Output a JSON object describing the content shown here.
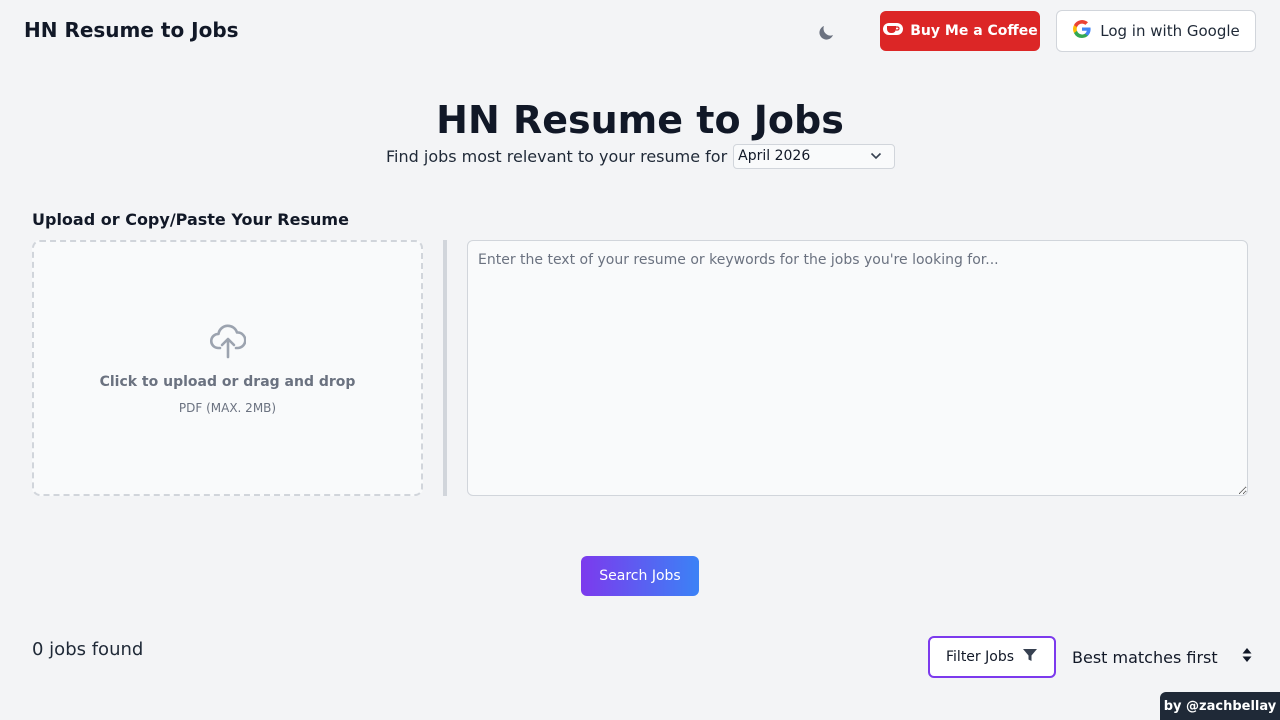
{
  "header": {
    "brand": "HN Resume to Jobs",
    "theme_toggle_icon": "moon-icon",
    "coffee_label": "Buy Me a Coffee",
    "coffee_icon": "coffee-cup-icon",
    "google_label": "Log in with Google",
    "google_icon": "google-icon"
  },
  "hero": {
    "title": "HN Resume to Jobs",
    "subtitle": "Find jobs most relevant to your resume for",
    "month_selected": "April 2026"
  },
  "upload": {
    "section_label": "Upload or Copy/Paste Your Resume",
    "dropzone_title": "Click to upload or drag and drop",
    "dropzone_sub": "PDF (MAX. 2MB)",
    "textarea_placeholder": "Enter the text of your resume or keywords for the jobs you're looking for..."
  },
  "actions": {
    "search_label": "Search Jobs"
  },
  "results": {
    "count_text": "0 jobs found",
    "filter_label": "Filter Jobs",
    "sort_selected": "Best matches first"
  },
  "footer": {
    "credit": "by @zachbellay"
  },
  "colors": {
    "accent_purple": "#7c3aed",
    "accent_blue": "#3b82f6",
    "coffee_red": "#dc2626",
    "background": "#f3f4f6"
  }
}
